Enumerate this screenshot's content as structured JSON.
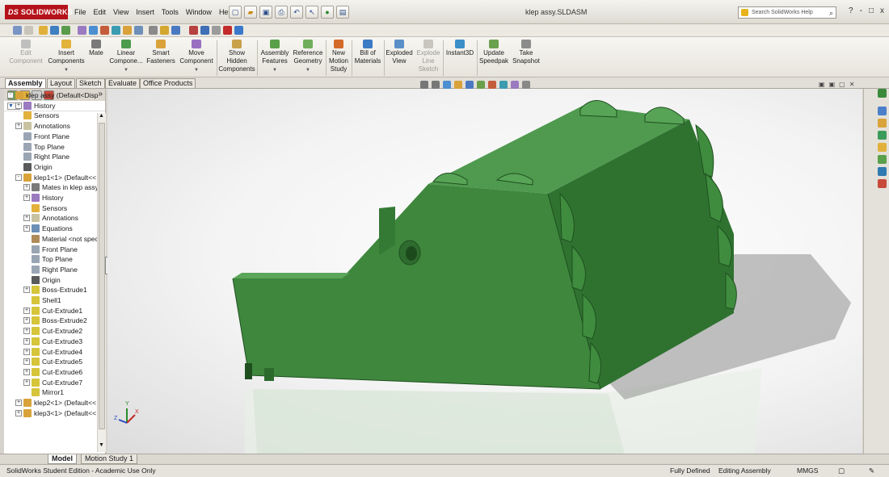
{
  "app": {
    "logo_text": "SOLIDWORKS",
    "logo_mark": "DS",
    "document_title": "klep assy.SLDASM",
    "search_placeholder": "Search SolidWorks Help",
    "search_icon": "magnifier-icon",
    "window_controls": [
      "?",
      "-",
      "□",
      "x"
    ],
    "accent_color": "#b5121b"
  },
  "menu": [
    "File",
    "Edit",
    "View",
    "Insert",
    "Tools",
    "Window",
    "Help"
  ],
  "command_manager": {
    "buttons": [
      {
        "label": "Edit Component",
        "disabled": true
      },
      {
        "label": "Insert Components",
        "disabled": false
      },
      {
        "label": "Mate",
        "disabled": false
      },
      {
        "label": "Linear Compone...",
        "disabled": false
      },
      {
        "label": "Smart Fasteners",
        "disabled": false
      },
      {
        "label": "Move Component",
        "disabled": false
      },
      {
        "label": "Show Hidden Components",
        "disabled": false
      },
      {
        "label": "Assembly Features",
        "disabled": false
      },
      {
        "label": "Reference Geometry",
        "disabled": false
      },
      {
        "label": "New Motion Study",
        "disabled": false
      },
      {
        "label": "Bill of Materials",
        "disabled": false
      },
      {
        "label": "Exploded View",
        "disabled": false
      },
      {
        "label": "Explode Line Sketch",
        "disabled": true
      },
      {
        "label": "Instant3D",
        "disabled": false
      },
      {
        "label": "Update Speedpak",
        "disabled": false
      },
      {
        "label": "Take Snapshot",
        "disabled": false
      }
    ]
  },
  "tabs": [
    "Assembly",
    "Layout",
    "Sketch",
    "Evaluate",
    "Office Products"
  ],
  "active_tab": "Assembly",
  "feature_tree": {
    "items": [
      {
        "label": "klep assy  (Default<Disp",
        "depth": 0,
        "toggle": "-",
        "icon": "assembly-icon"
      },
      {
        "label": "History",
        "depth": 1,
        "toggle": "+",
        "icon": "history-icon"
      },
      {
        "label": "Sensors",
        "depth": 1,
        "toggle": "",
        "icon": "sensor-icon"
      },
      {
        "label": "Annotations",
        "depth": 1,
        "toggle": "+",
        "icon": "annotation-icon"
      },
      {
        "label": "Front Plane",
        "depth": 1,
        "toggle": "",
        "icon": "plane-icon"
      },
      {
        "label": "Top Plane",
        "depth": 1,
        "toggle": "",
        "icon": "plane-icon"
      },
      {
        "label": "Right Plane",
        "depth": 1,
        "toggle": "",
        "icon": "plane-icon"
      },
      {
        "label": "Origin",
        "depth": 1,
        "toggle": "",
        "icon": "origin-icon"
      },
      {
        "label": "klep1<1> (Default<<",
        "depth": 1,
        "toggle": "-",
        "icon": "part-icon"
      },
      {
        "label": "Mates in klep assy",
        "depth": 2,
        "toggle": "+",
        "icon": "mate-icon"
      },
      {
        "label": "History",
        "depth": 2,
        "toggle": "+",
        "icon": "history-icon"
      },
      {
        "label": "Sensors",
        "depth": 2,
        "toggle": "",
        "icon": "sensor-icon"
      },
      {
        "label": "Annotations",
        "depth": 2,
        "toggle": "+",
        "icon": "annotation-icon"
      },
      {
        "label": "Equations",
        "depth": 2,
        "toggle": "+",
        "icon": "equation-icon"
      },
      {
        "label": "Material <not specifi",
        "depth": 2,
        "toggle": "",
        "icon": "material-icon"
      },
      {
        "label": "Front Plane",
        "depth": 2,
        "toggle": "",
        "icon": "plane-icon"
      },
      {
        "label": "Top Plane",
        "depth": 2,
        "toggle": "",
        "icon": "plane-icon"
      },
      {
        "label": "Right Plane",
        "depth": 2,
        "toggle": "",
        "icon": "plane-icon"
      },
      {
        "label": "Origin",
        "depth": 2,
        "toggle": "",
        "icon": "origin-icon"
      },
      {
        "label": "Boss-Extrude1",
        "depth": 2,
        "toggle": "+",
        "icon": "feature-icon"
      },
      {
        "label": "Shell1",
        "depth": 2,
        "toggle": "",
        "icon": "feature-icon"
      },
      {
        "label": "Cut-Extrude1",
        "depth": 2,
        "toggle": "+",
        "icon": "feature-icon"
      },
      {
        "label": "Boss-Extrude2",
        "depth": 2,
        "toggle": "+",
        "icon": "feature-icon"
      },
      {
        "label": "Cut-Extrude2",
        "depth": 2,
        "toggle": "+",
        "icon": "feature-icon"
      },
      {
        "label": "Cut-Extrude3",
        "depth": 2,
        "toggle": "+",
        "icon": "feature-icon"
      },
      {
        "label": "Cut-Extrude4",
        "depth": 2,
        "toggle": "+",
        "icon": "feature-icon"
      },
      {
        "label": "Cut-Extrude5",
        "depth": 2,
        "toggle": "+",
        "icon": "feature-icon"
      },
      {
        "label": "Cut-Extrude6",
        "depth": 2,
        "toggle": "+",
        "icon": "feature-icon"
      },
      {
        "label": "Cut-Extrude7",
        "depth": 2,
        "toggle": "+",
        "icon": "feature-icon"
      },
      {
        "label": "Mirror1",
        "depth": 2,
        "toggle": "",
        "icon": "feature-icon"
      },
      {
        "label": "klep2<1> (Default<<",
        "depth": 1,
        "toggle": "+",
        "icon": "part-icon"
      },
      {
        "label": "klep3<1> (Default<<",
        "depth": 1,
        "toggle": "+",
        "icon": "part-icon"
      }
    ]
  },
  "model_color": "#3d8a3d",
  "bottom_tabs": [
    "Model",
    "Motion Study 1"
  ],
  "active_bottom_tab": "Model",
  "status": {
    "edition": "SolidWorks Student Edition - Academic Use Only",
    "definition": "Fully Defined",
    "mode": "Editing Assembly",
    "units": "MMGS"
  }
}
